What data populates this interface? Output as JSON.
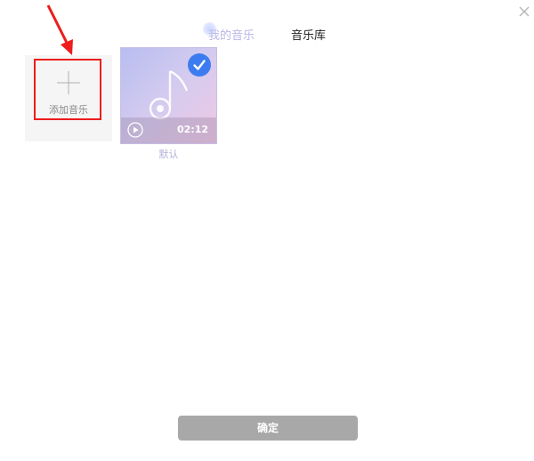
{
  "tabs": [
    {
      "label": "我的音乐",
      "active": true
    },
    {
      "label": "音乐库",
      "active": false
    }
  ],
  "add_card": {
    "label": "添加音乐",
    "icon": "plus-icon"
  },
  "music_items": [
    {
      "name": "默认",
      "duration": "02:12",
      "selected": true
    }
  ],
  "footer": {
    "confirm_label": "确定"
  },
  "colors": {
    "accent_blue": "#3d7cf0",
    "highlight_red": "#ee1c1c",
    "confirm_bg": "#a8a8a8",
    "tab_active": "#b9b7e8"
  }
}
